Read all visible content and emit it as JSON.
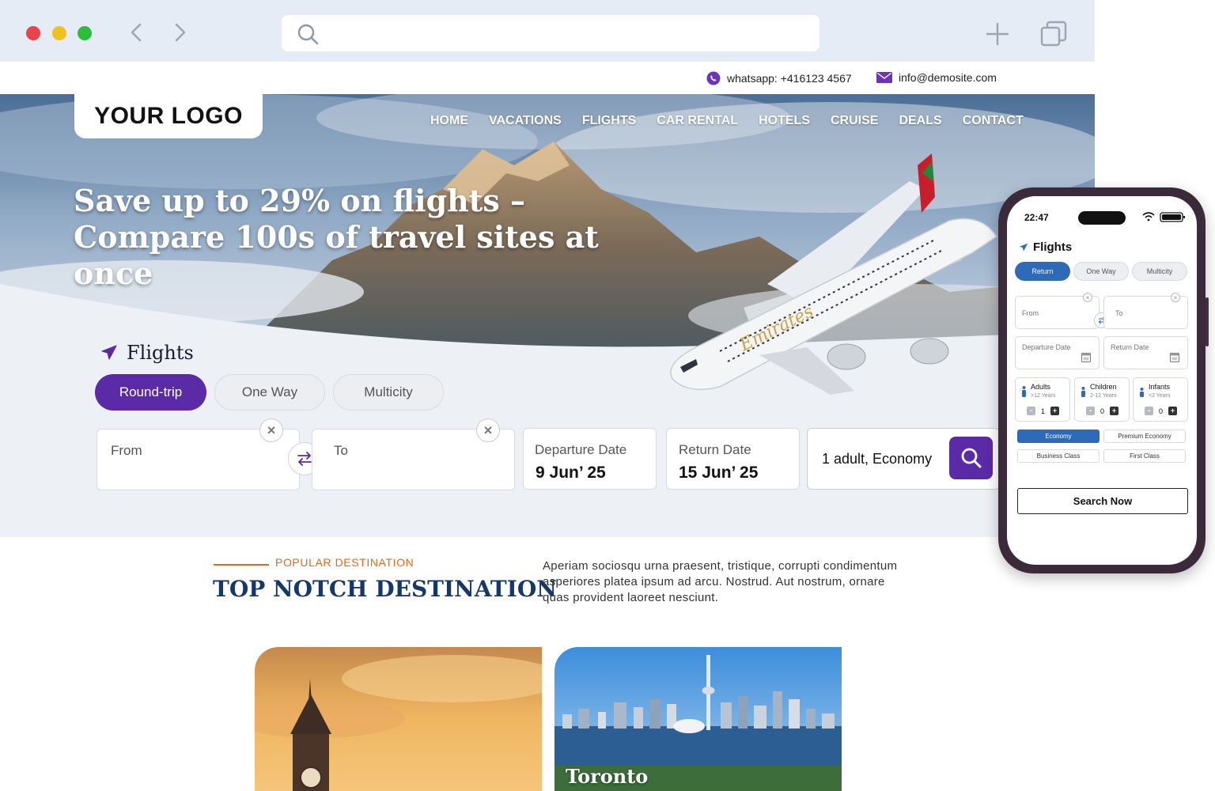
{
  "browser": {
    "address_value": "",
    "icons": [
      "back-arrow-icon",
      "forward-arrow-icon",
      "search-icon",
      "new-tab-plus-icon",
      "tabs-icon"
    ]
  },
  "contact": {
    "whatsapp": "whatsapp: +416123 4567",
    "email": "info@demosite.com"
  },
  "brand": {
    "logo": "YOUR LOGO",
    "accent_color": "#5b2aa6",
    "heading_color": "#153769",
    "kicker_color": "#e0691c"
  },
  "nav": {
    "items": [
      "HOME",
      "VACATIONS",
      "FLIGHTS",
      "CAR RENTAL",
      "HOTELS",
      "CRUISE",
      "DEALS",
      "CONTACT"
    ]
  },
  "hero": {
    "title": "Save up to 29% on flights – Compare 100s of travel sites at once"
  },
  "search": {
    "section_title": "Flights",
    "trip_types": [
      "Round-trip",
      "One Way",
      "Multicity"
    ],
    "active_trip": "Round-trip",
    "from_label": "From",
    "to_label": "To",
    "clear_symbol": "×",
    "departure_label": "Departure Date",
    "departure_value": "9 Jun’ 25",
    "return_label": "Return Date",
    "return_value": "15 Jun’ 25",
    "passengers_value": "1 adult, Economy"
  },
  "popular": {
    "kicker": "POPULAR DESTINATION",
    "title": "TOP NOTCH DESTINATION",
    "description": "Aperiam sociosqu urna praesent, tristique, corrupti condimentum asperiores platea ipsum ad arcu. Nostrud. Aut nostrum, ornare quas provident laoreet nesciunt.",
    "cards": [
      {
        "name": ""
      },
      {
        "name": "Toronto"
      }
    ]
  },
  "phone": {
    "time": "22:47",
    "title": "Flights",
    "tabs": [
      "Return",
      "One Way",
      "Multicity"
    ],
    "from_label": "From",
    "to_label": "To",
    "clear_symbol": "×",
    "departure_label": "Departure Date",
    "return_label": "Return Date",
    "passengers": [
      {
        "name": "Adults",
        "age": ">12 Years",
        "count": "1"
      },
      {
        "name": "Children",
        "age": "2-12 Years",
        "count": "0"
      },
      {
        "name": "Infants",
        "age": "<2 Years",
        "count": "0"
      }
    ],
    "minus": "-",
    "plus": "+",
    "classes": [
      "Economy",
      "Premium Economy",
      "Business Class",
      "First Class"
    ],
    "active_class": "Economy",
    "search_button": "Search Now",
    "tab_color": "#2f6ab8"
  }
}
